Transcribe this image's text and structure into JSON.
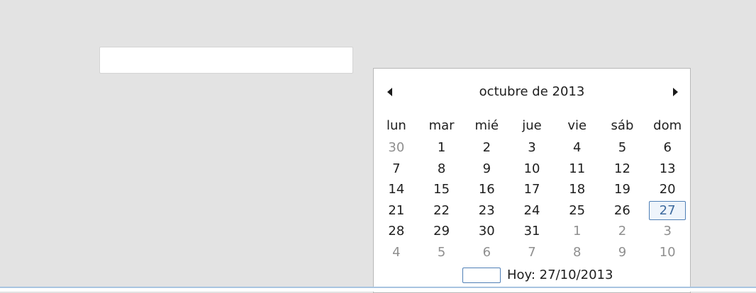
{
  "input": {
    "value": "",
    "placeholder": ""
  },
  "calendar": {
    "month_title": "octubre de 2013",
    "prev_icon": "triangle-left",
    "next_icon": "triangle-right",
    "weekdays": [
      "lun",
      "mar",
      "mié",
      "jue",
      "vie",
      "sáb",
      "dom"
    ],
    "weeks": [
      [
        {
          "d": "30",
          "other": true
        },
        {
          "d": "1",
          "other": false
        },
        {
          "d": "2",
          "other": false
        },
        {
          "d": "3",
          "other": false
        },
        {
          "d": "4",
          "other": false
        },
        {
          "d": "5",
          "other": false
        },
        {
          "d": "6",
          "other": false
        }
      ],
      [
        {
          "d": "7",
          "other": false
        },
        {
          "d": "8",
          "other": false
        },
        {
          "d": "9",
          "other": false
        },
        {
          "d": "10",
          "other": false
        },
        {
          "d": "11",
          "other": false
        },
        {
          "d": "12",
          "other": false
        },
        {
          "d": "13",
          "other": false
        }
      ],
      [
        {
          "d": "14",
          "other": false
        },
        {
          "d": "15",
          "other": false
        },
        {
          "d": "16",
          "other": false
        },
        {
          "d": "17",
          "other": false
        },
        {
          "d": "18",
          "other": false
        },
        {
          "d": "19",
          "other": false
        },
        {
          "d": "20",
          "other": false
        }
      ],
      [
        {
          "d": "21",
          "other": false
        },
        {
          "d": "22",
          "other": false
        },
        {
          "d": "23",
          "other": false
        },
        {
          "d": "24",
          "other": false
        },
        {
          "d": "25",
          "other": false
        },
        {
          "d": "26",
          "other": false
        },
        {
          "d": "27",
          "other": false,
          "today": true
        }
      ],
      [
        {
          "d": "28",
          "other": false
        },
        {
          "d": "29",
          "other": false
        },
        {
          "d": "30",
          "other": false
        },
        {
          "d": "31",
          "other": false
        },
        {
          "d": "1",
          "other": true
        },
        {
          "d": "2",
          "other": true
        },
        {
          "d": "3",
          "other": true
        }
      ],
      [
        {
          "d": "4",
          "other": true
        },
        {
          "d": "5",
          "other": true
        },
        {
          "d": "6",
          "other": true
        },
        {
          "d": "7",
          "other": true
        },
        {
          "d": "8",
          "other": true
        },
        {
          "d": "9",
          "other": true
        },
        {
          "d": "10",
          "other": true
        }
      ]
    ],
    "today_label": "Hoy: 27/10/2013"
  },
  "colors": {
    "background": "#e3e3e3",
    "today_border": "#4f7fb6",
    "other_month_text": "#8f8f8f"
  }
}
